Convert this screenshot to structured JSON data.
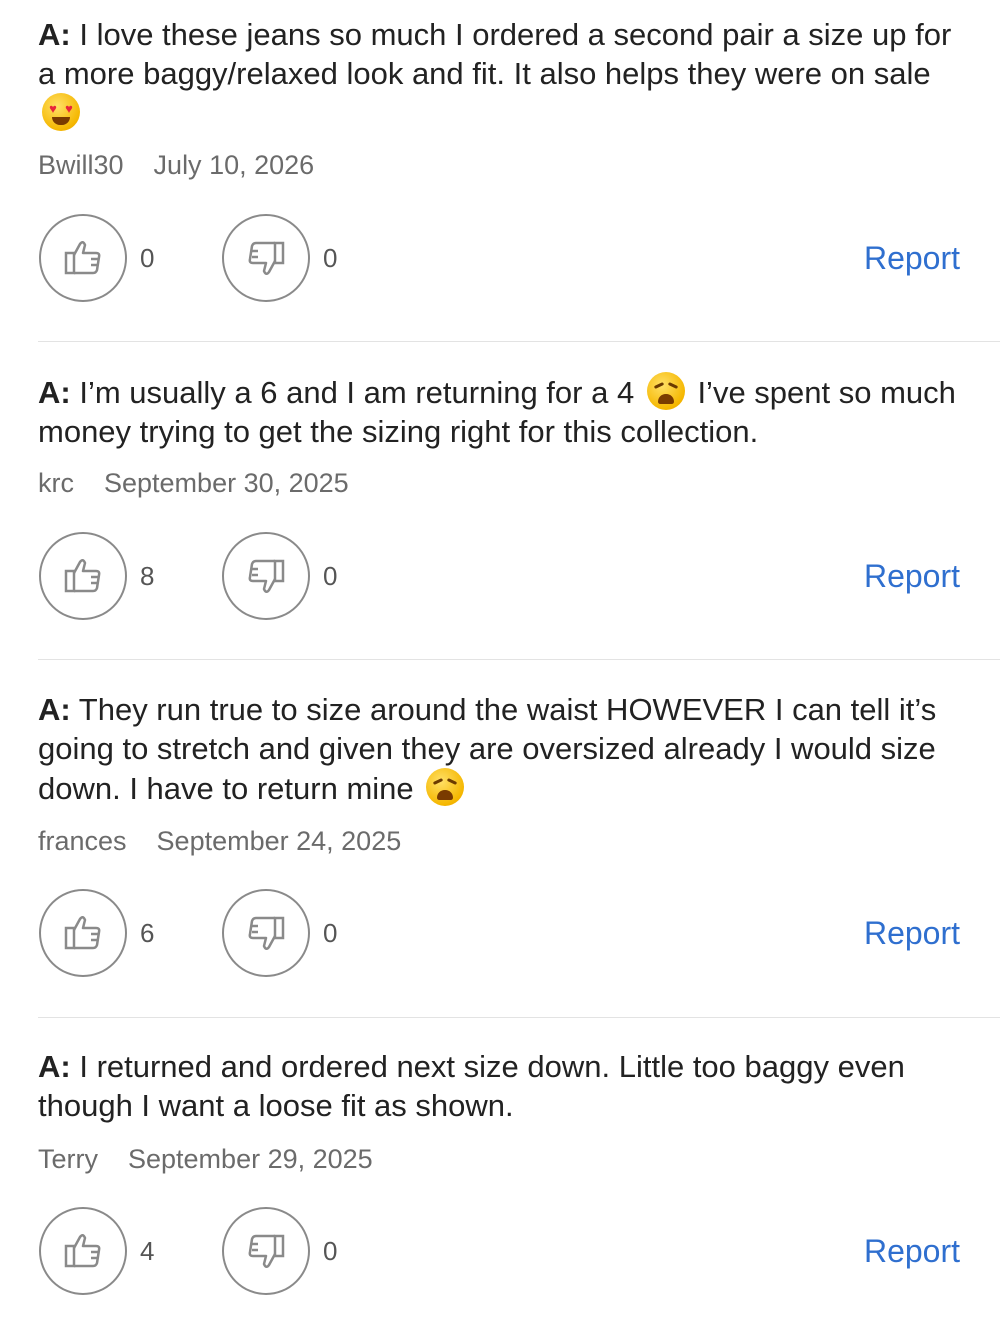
{
  "answer_prefix": "A:",
  "report_label": "Report",
  "colors": {
    "link": "#2f6fcf",
    "meta_text": "#6b6b6b",
    "divider": "#e3e3e3"
  },
  "answers": [
    {
      "text_before_emoji": "I love these jeans so much I ordered a second pair a size up for a more baggy/relaxed look and fit. It also helps they were on sale",
      "emoji": "smiling-face-with-heart-eyes",
      "text_after_emoji": "",
      "author": "Bwill30",
      "date": "July 10, 2026",
      "helpful_count": "0",
      "not_helpful_count": "0"
    },
    {
      "text_before_emoji": "I’m usually a 6 and I am returning for a 4",
      "emoji": "weary-face",
      "text_after_emoji": "I’ve spent so much money trying to get the sizing right for this collection.",
      "author": "krc",
      "date": "September 30, 2025",
      "helpful_count": "8",
      "not_helpful_count": "0"
    },
    {
      "text_before_emoji": "They run true to size around the waist HOWEVER  I can tell it’s going to stretch and given they are oversized already I would size down. I have to return mine",
      "emoji": "weary-face",
      "text_after_emoji": "",
      "author": "frances",
      "date": "September 24, 2025",
      "helpful_count": "6",
      "not_helpful_count": "0"
    },
    {
      "text_before_emoji": "I returned and ordered next size down. Little too baggy even though I want a loose fit as shown.",
      "emoji": "",
      "text_after_emoji": "",
      "author": "Terry",
      "date": "September 29, 2025",
      "helpful_count": "4",
      "not_helpful_count": "0"
    }
  ]
}
